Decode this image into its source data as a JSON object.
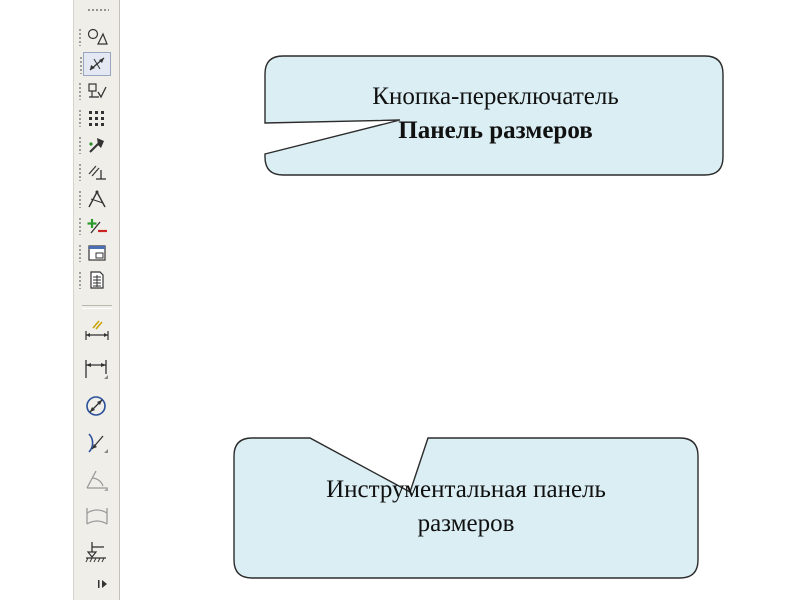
{
  "toolbar": {
    "tools": [
      {
        "name": "geometry-tool-icon"
      },
      {
        "name": "dimensions-toggle-icon"
      },
      {
        "name": "designations-tool-icon"
      },
      {
        "name": "editing-tool-icon"
      },
      {
        "name": "parametrization-tool-icon"
      },
      {
        "name": "measurements-tool-icon"
      },
      {
        "name": "selection-tool-icon"
      },
      {
        "name": "associative-views-icon"
      },
      {
        "name": "report-tool-icon"
      },
      {
        "name": "spec-tool-icon"
      },
      {
        "name": "auto-dimension-icon"
      },
      {
        "name": "linear-dimension-icon"
      },
      {
        "name": "diameter-dimension-icon"
      },
      {
        "name": "radial-dimension-icon"
      },
      {
        "name": "angular-dimension-icon"
      },
      {
        "name": "arc-dimension-icon"
      },
      {
        "name": "height-mark-icon"
      }
    ],
    "pressed_index": 1
  },
  "callouts": {
    "toggle": {
      "line1": "Кнопка-переключатель",
      "line2": "Панель размеров"
    },
    "panel": {
      "line1": "Инструментальная панель",
      "line2": "размеров"
    }
  },
  "colors": {
    "callout_fill": "#daeef3",
    "callout_stroke": "#2b2b2b",
    "toolbar_bg": "#efeee9",
    "pressed_bg": "#e3e8f2"
  }
}
